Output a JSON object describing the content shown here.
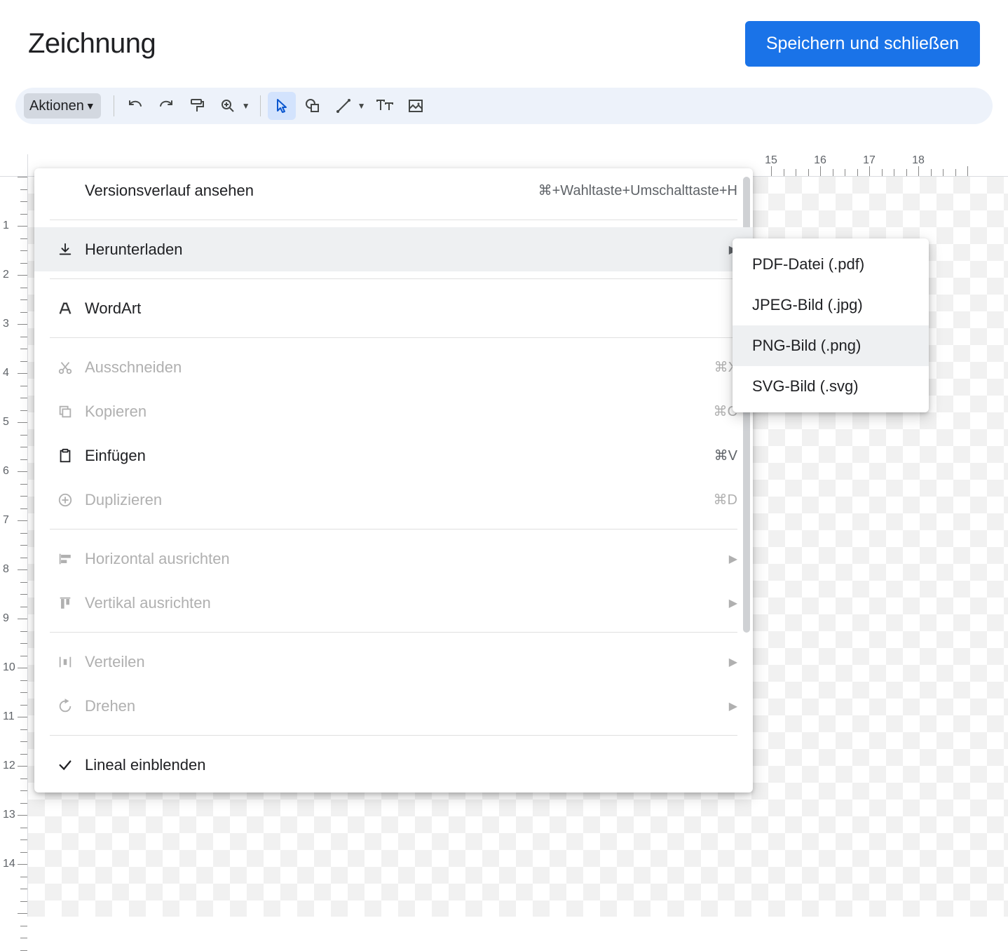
{
  "header": {
    "title": "Zeichnung",
    "save_label": "Speichern und schließen"
  },
  "toolbar": {
    "actions_label": "Aktionen"
  },
  "menu": {
    "items": [
      {
        "label": "Versionsverlauf ansehen",
        "shortcut": "⌘+Wahltaste+Umschalttaste+H",
        "icon": "",
        "sep_after": true
      },
      {
        "label": "Herunterladen",
        "icon": "download",
        "submenu": true,
        "hovered": true,
        "sep_after": true
      },
      {
        "label": "WordArt",
        "icon": "wordart",
        "sep_after": true
      },
      {
        "label": "Ausschneiden",
        "icon": "cut",
        "shortcut": "⌘X",
        "disabled": true
      },
      {
        "label": "Kopieren",
        "icon": "copy",
        "shortcut": "⌘C",
        "disabled": true
      },
      {
        "label": "Einfügen",
        "icon": "paste",
        "shortcut": "⌘V"
      },
      {
        "label": "Duplizieren",
        "icon": "duplicate",
        "shortcut": "⌘D",
        "disabled": true,
        "sep_after": true
      },
      {
        "label": "Horizontal ausrichten",
        "icon": "align-h",
        "submenu": true,
        "disabled": true
      },
      {
        "label": "Vertikal ausrichten",
        "icon": "align-v",
        "submenu": true,
        "disabled": true,
        "sep_after": true
      },
      {
        "label": "Verteilen",
        "icon": "distribute",
        "submenu": true,
        "disabled": true
      },
      {
        "label": "Drehen",
        "icon": "rotate",
        "submenu": true,
        "disabled": true,
        "sep_after": true
      },
      {
        "label": "Lineal einblenden",
        "icon": "check"
      }
    ]
  },
  "submenu": {
    "items": [
      {
        "label": "PDF-Datei (.pdf)"
      },
      {
        "label": "JPEG-Bild (.jpg)"
      },
      {
        "label": "PNG-Bild (.png)",
        "hovered": true
      },
      {
        "label": "SVG-Bild (.svg)"
      }
    ]
  },
  "ruler": {
    "h_labels": [
      15,
      16,
      17,
      18
    ],
    "v_labels": [
      1,
      2,
      3,
      4,
      5,
      6,
      7,
      8,
      9,
      10,
      11,
      12,
      13,
      14
    ]
  }
}
